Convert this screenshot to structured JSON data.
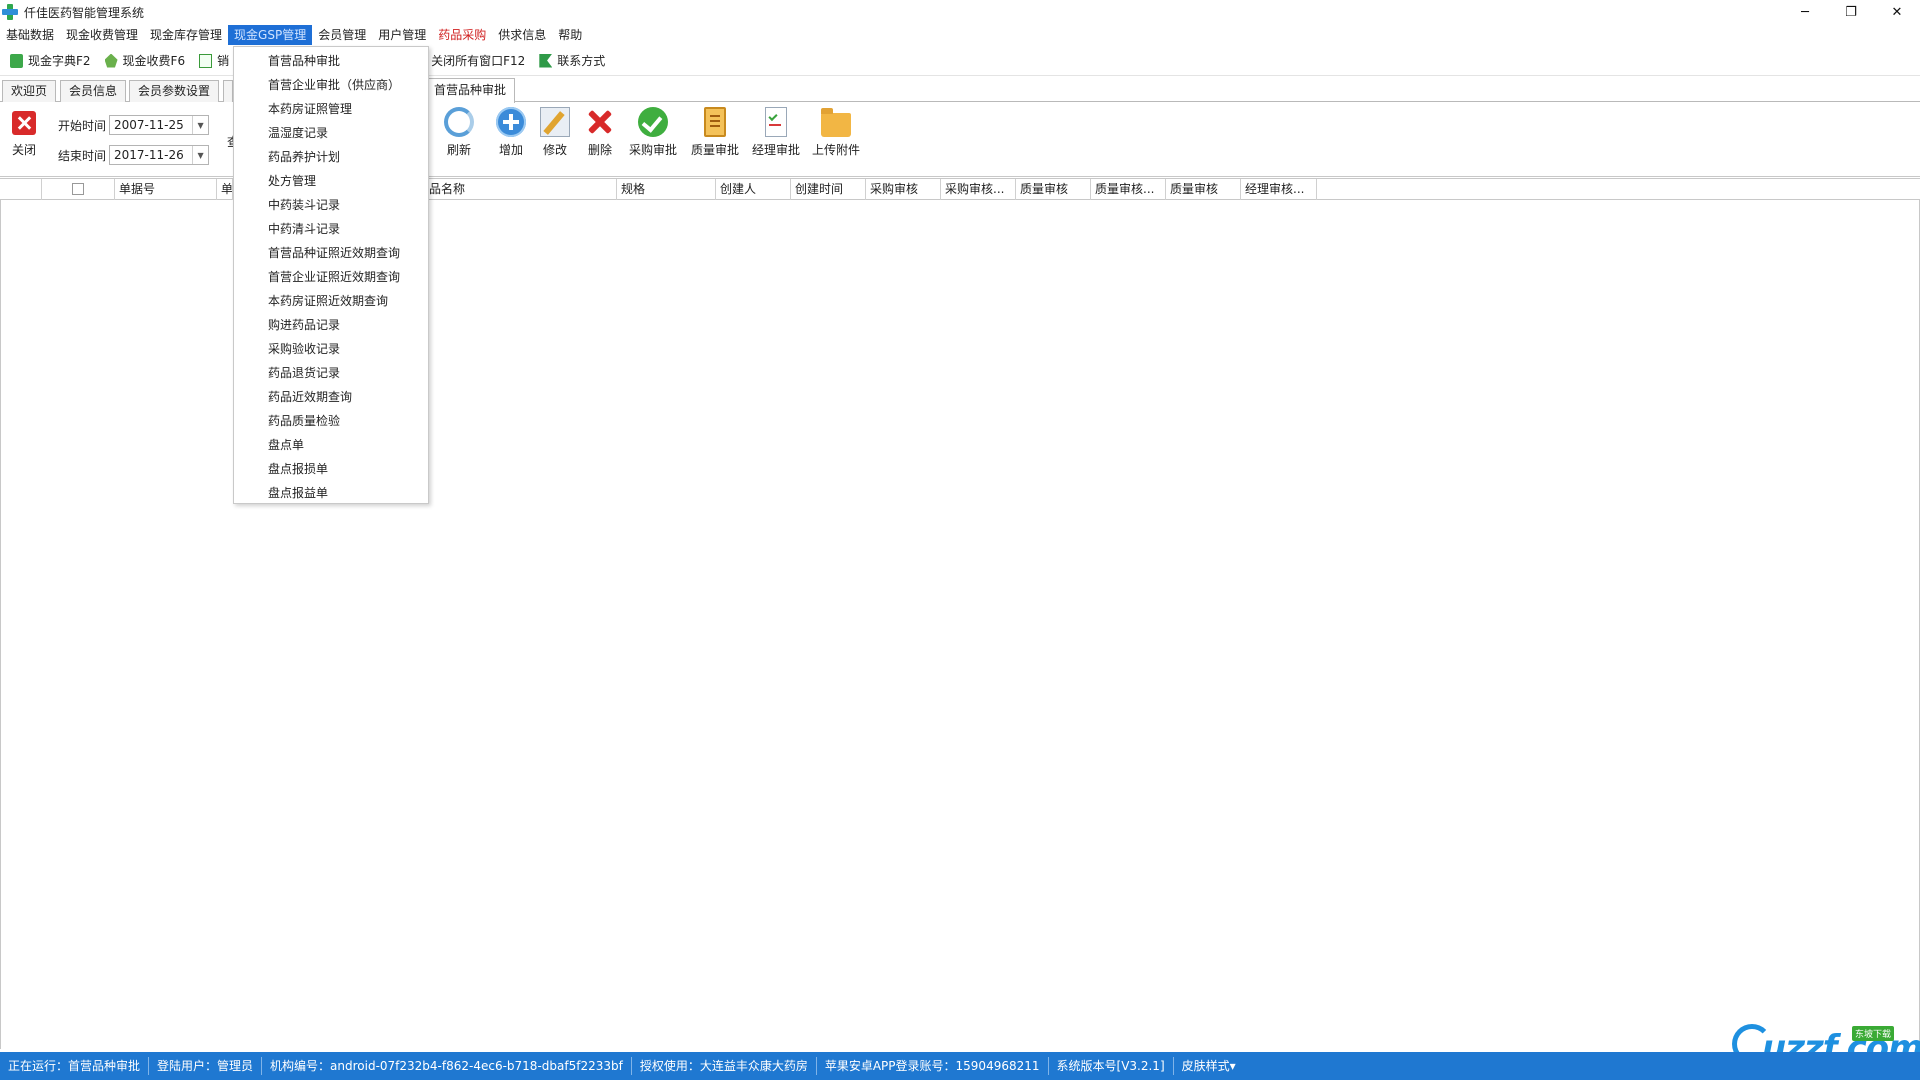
{
  "window": {
    "title": "仟佳医药智能管理系统",
    "controls": {
      "minimize": "─",
      "restore": "❐",
      "close": "✕"
    }
  },
  "menubar": {
    "items": [
      {
        "label": "基础数据"
      },
      {
        "label": "现金收费管理"
      },
      {
        "label": "现金库存管理"
      },
      {
        "label": "现金GSP管理",
        "active": true
      },
      {
        "label": "会员管理"
      },
      {
        "label": "用户管理"
      },
      {
        "label": "药品采购",
        "color": "#d02020"
      },
      {
        "label": "供求信息"
      },
      {
        "label": "帮助"
      }
    ]
  },
  "quickbar": {
    "items": [
      {
        "label": "现金字典F2",
        "icon": "dictionary-icon"
      },
      {
        "label": "现金收费F6",
        "icon": "charge-icon"
      },
      {
        "label": "销",
        "icon": "sale-icon"
      },
      {
        "label": "关闭所有窗口F12",
        "icon": "close-all-icon"
      },
      {
        "label": "联系方式",
        "icon": "contact-icon"
      }
    ]
  },
  "tabs": [
    {
      "label": "欢迎页"
    },
    {
      "label": "会员信息"
    },
    {
      "label": "会员参数设置"
    },
    {
      "label": "首营品种审批",
      "active": true
    }
  ],
  "actionbar": {
    "close_label": "关闭",
    "start_label": "开始时间",
    "start_value": "2007-11-25",
    "end_label": "结束时间",
    "end_value": "2017-11-26",
    "query_stub": "查",
    "buttons": [
      {
        "label": "刷新",
        "icon": "refresh-icon"
      },
      {
        "label": "增加",
        "icon": "add-icon"
      },
      {
        "label": "修改",
        "icon": "edit-icon"
      },
      {
        "label": "删除",
        "icon": "delete-icon"
      },
      {
        "label": "采购审批",
        "icon": "purchase-approve-icon"
      },
      {
        "label": "质量审批",
        "icon": "quality-approve-icon"
      },
      {
        "label": "经理审批",
        "icon": "manager-approve-icon"
      },
      {
        "label": "上传附件",
        "icon": "upload-attachment-icon"
      }
    ]
  },
  "grid": {
    "columns": [
      "单据号",
      "单",
      "品名称",
      "规格",
      "创建人",
      "创建时间",
      "采购审核",
      "采购审核...",
      "质量审核",
      "质量审核...",
      "质量审核",
      "经理审核..."
    ],
    "rows": []
  },
  "dropdown": {
    "items": [
      "首营品种审批",
      "首营企业审批（供应商）",
      "本药房证照管理",
      "温湿度记录",
      "药品养护计划",
      "处方管理",
      "中药装斗记录",
      "中药清斗记录",
      "首营品种证照近效期查询",
      "首营企业证照近效期查询",
      "本药房证照近效期查询",
      "购进药品记录",
      "采购验收记录",
      "药品退货记录",
      "药品近效期查询",
      "药品质量检验",
      "盘点单",
      "盘点报损单",
      "盘点报益单"
    ]
  },
  "statusbar": {
    "items": [
      "正在运行：首营品种审批",
      "登陆用户：管理员",
      "机构编号：android-07f232b4-f862-4ec6-b718-dbaf5f2233bf",
      "授权使用：大连益丰众康大药房",
      "苹果安卓APP登录账号：15904968211",
      "系统版本号[V3.2.1]",
      "皮肤样式▾"
    ]
  },
  "watermark": {
    "text": "uzzf.com",
    "badge": "东坡下载"
  },
  "colors": {
    "accent": "#1f78d1",
    "menu_active": "#1e6fd6",
    "danger": "#d82a2a"
  }
}
